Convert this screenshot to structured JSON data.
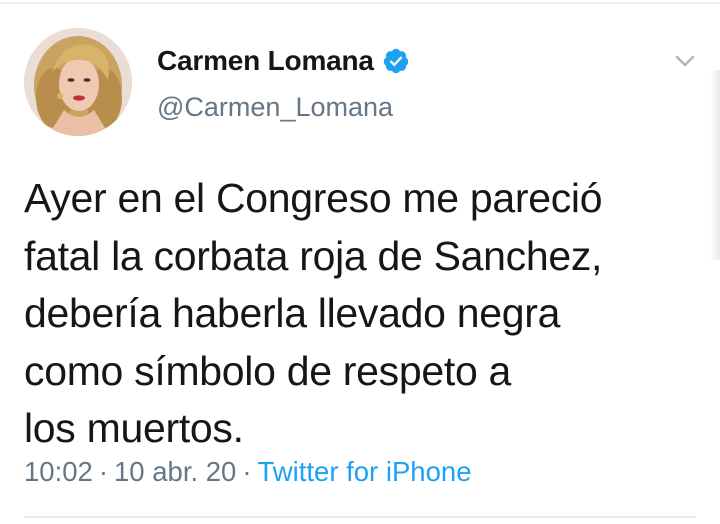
{
  "tweet": {
    "author": {
      "name": "Carmen Lomana",
      "handle": "@Carmen_Lomana",
      "verified": true
    },
    "text": "Ayer en el Congreso me pareció\nfatal la corbata roja de Sanchez,\ndebería haberla llevado negra\ncomo símbolo de respeto a\nlos muertos.",
    "time": "10:02",
    "separator": "·",
    "date": "10 abr. 20",
    "source": "Twitter for iPhone"
  },
  "icons": {
    "verified": "verified-badge-icon",
    "menu": "chevron-down-icon"
  },
  "colors": {
    "text": "#14171a",
    "secondary": "#657786",
    "accent": "#1da1f2",
    "divider": "#e6ecf0"
  }
}
